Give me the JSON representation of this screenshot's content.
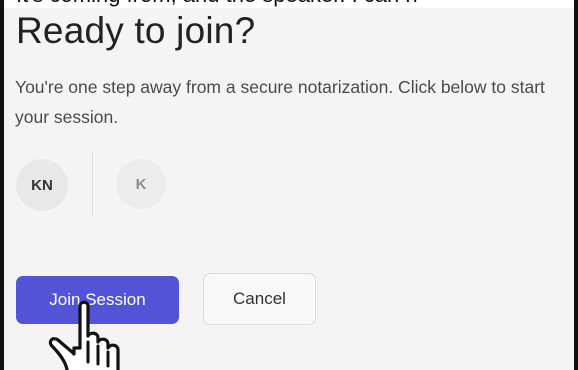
{
  "caption": {
    "text": "It's coming from, and the speaker. I can h"
  },
  "dialog": {
    "title": "Ready to join?",
    "subtitle": "You're one step away from a secure notarization. Click below to start your session."
  },
  "participants": [
    {
      "initials": "KN"
    },
    {
      "initials": "K"
    }
  ],
  "actions": {
    "join_label": "Join Session",
    "cancel_label": "Cancel"
  },
  "colors": {
    "primary": "#5253d6",
    "background": "#f4f4f4",
    "avatar_bg": "#e8e8e8"
  },
  "icons": {
    "cursor": "hand-pointer-icon"
  }
}
